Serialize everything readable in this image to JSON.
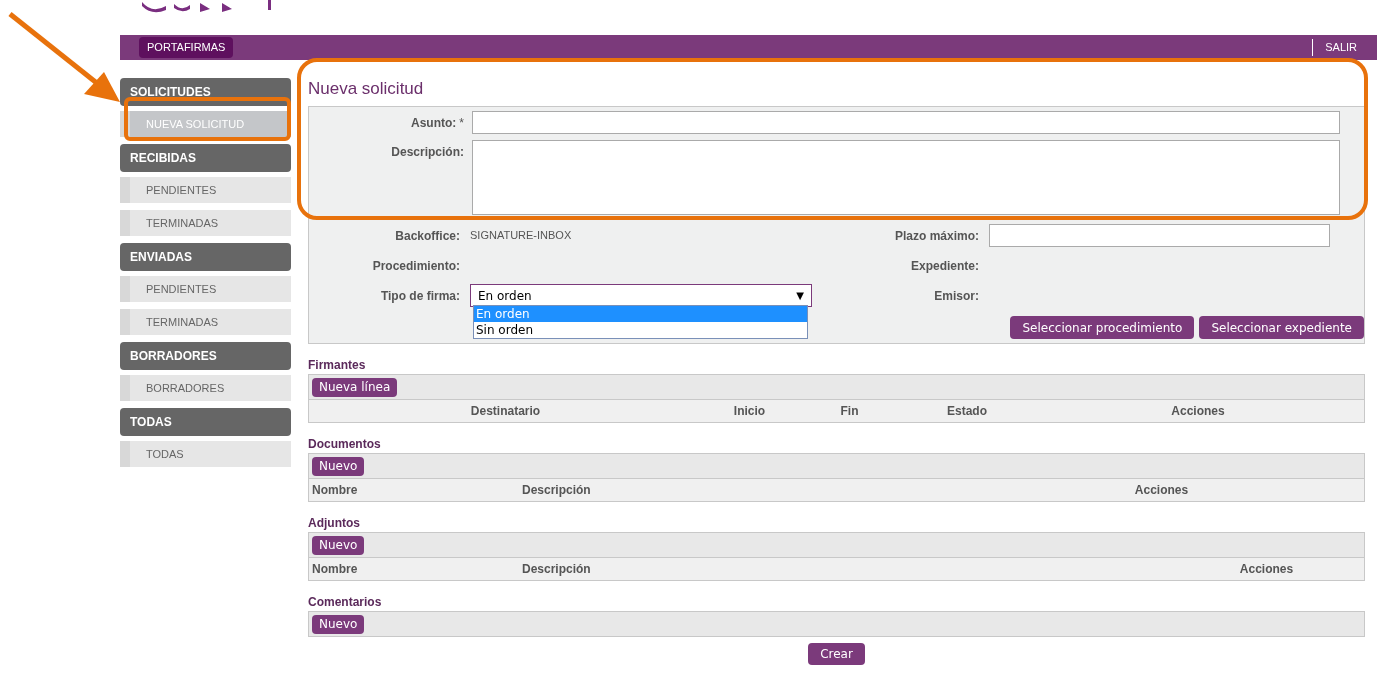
{
  "header": {
    "tab": "PORTAFIRMAS",
    "logout": "SALIR"
  },
  "sidebar": [
    {
      "title": "SOLICITUDES",
      "items": [
        {
          "label": "NUEVA SOLICITUD",
          "selected": true
        }
      ]
    },
    {
      "title": "RECIBIDAS",
      "items": [
        {
          "label": "PENDIENTES",
          "selected": false
        },
        {
          "label": "TERMINADAS",
          "selected": false
        }
      ]
    },
    {
      "title": "ENVIADAS",
      "items": [
        {
          "label": "PENDIENTES",
          "selected": false
        },
        {
          "label": "TERMINADAS",
          "selected": false
        }
      ]
    },
    {
      "title": "BORRADORES",
      "items": [
        {
          "label": "BORRADORES",
          "selected": false
        }
      ]
    },
    {
      "title": "TODAS",
      "items": [
        {
          "label": "TODAS",
          "selected": false
        }
      ]
    }
  ],
  "form": {
    "title": "Nueva solicitud",
    "main_fields": [
      {
        "kind": "text",
        "label": "Asunto:",
        "required_mark": "*"
      },
      {
        "kind": "textarea",
        "label": "Descripción:"
      }
    ],
    "left_fields": [
      {
        "kind": "static",
        "label": "Backoffice:",
        "value": "SIGNATURE-INBOX"
      },
      {
        "kind": "static",
        "label": "Procedimiento:"
      },
      {
        "kind": "select",
        "label": "Tipo de firma:",
        "value": "En orden",
        "arrow": "▼",
        "expanded": true,
        "options": [
          {
            "label": "En orden",
            "selected": true
          },
          {
            "label": "Sin orden",
            "selected": false
          }
        ]
      }
    ],
    "right_fields": [
      {
        "kind": "text",
        "label": "Plazo máximo:"
      },
      {
        "kind": "static",
        "label": "Expediente:"
      },
      {
        "kind": "static",
        "label": "Emisor:"
      }
    ],
    "buttons": [
      "Seleccionar procedimiento",
      "Seleccionar expediente"
    ]
  },
  "sections": [
    {
      "title": "Firmantes",
      "button": "Nueva línea",
      "columns": [
        "Destinatario",
        "Inicio",
        "Fin",
        "Estado",
        "Acciones"
      ]
    },
    {
      "title": "Documentos",
      "button": "Nuevo",
      "columns": [
        "Nombre",
        "Descripción",
        "Acciones"
      ]
    },
    {
      "title": "Adjuntos",
      "button": "Nuevo",
      "columns": [
        "Nombre",
        "Descripción",
        "Acciones"
      ]
    },
    {
      "title": "Comentarios",
      "button": "Nuevo"
    }
  ],
  "submit": "Crear"
}
